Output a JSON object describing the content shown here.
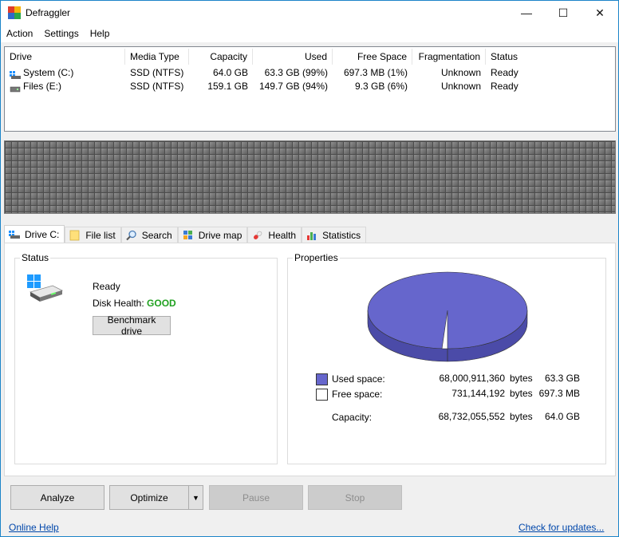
{
  "window": {
    "title": "Defraggler",
    "controls": {
      "minimize": "—",
      "maximize": "☐",
      "close": "✕"
    }
  },
  "menu": [
    "Action",
    "Settings",
    "Help"
  ],
  "drive_list": {
    "columns": [
      "Drive",
      "Media Type",
      "Capacity",
      "Used",
      "Free Space",
      "Fragmentation",
      "Status"
    ],
    "rows": [
      {
        "drive": "System (C:)",
        "media_type": "SSD (NTFS)",
        "capacity": "64.0 GB",
        "used": "63.3 GB (99%)",
        "free": "697.3 MB (1%)",
        "fragmentation": "Unknown",
        "status": "Ready"
      },
      {
        "drive": "Files (E:)",
        "media_type": "SSD (NTFS)",
        "capacity": "159.1 GB",
        "used": "149.7 GB (94%)",
        "free": "9.3 GB (6%)",
        "fragmentation": "Unknown",
        "status": "Ready"
      }
    ]
  },
  "tabs": [
    {
      "label": "Drive C:",
      "icon": "drive-icon",
      "active": true
    },
    {
      "label": "File list",
      "icon": "folder-icon",
      "active": false
    },
    {
      "label": "Search",
      "icon": "magnifier-icon",
      "active": false
    },
    {
      "label": "Drive map",
      "icon": "drive-map-icon",
      "active": false
    },
    {
      "label": "Health",
      "icon": "pill-icon",
      "active": false
    },
    {
      "label": "Statistics",
      "icon": "bar-chart-icon",
      "active": false
    }
  ],
  "status_group": {
    "title": "Status",
    "state": "Ready",
    "disk_health_label": "Disk Health:",
    "disk_health_value": "GOOD",
    "benchmark_button": "Benchmark drive"
  },
  "properties_group": {
    "title": "Properties",
    "used_fraction": 0.989,
    "colors": {
      "used": "#6666cc",
      "free": "#ffffff"
    },
    "used_label": "Used space:",
    "used_bytes": "68,000,911,360",
    "used_unit": "bytes",
    "used_human": "63.3 GB",
    "free_label": "Free space:",
    "free_bytes": "731,144,192",
    "free_unit": "bytes",
    "free_human": "697.3 MB",
    "capacity_label": "Capacity:",
    "capacity_bytes": "68,732,055,552",
    "capacity_unit": "bytes",
    "capacity_human": "64.0 GB"
  },
  "buttons": {
    "analyze": "Analyze",
    "optimize": "Optimize",
    "pause": "Pause",
    "stop": "Stop"
  },
  "links": {
    "online_help": "Online Help",
    "check_updates": "Check for updates..."
  }
}
